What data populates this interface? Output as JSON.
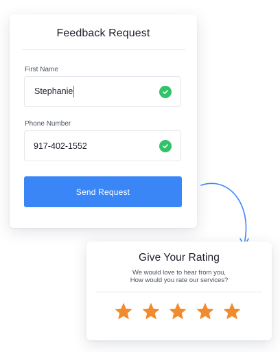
{
  "feedback_form": {
    "title": "Feedback Request",
    "first_name": {
      "label": "First Name",
      "value": "Stephanie",
      "status_icon": "check-circle-icon"
    },
    "phone_number": {
      "label": "Phone Number",
      "value": "917-402-1552",
      "status_icon": "check-circle-icon"
    },
    "submit_label": "Send Request"
  },
  "rating_card": {
    "title": "Give Your Rating",
    "subtitle_line1": "We would love to hear from you,",
    "subtitle_line2": "How would you rate our services?",
    "stars_total": 5,
    "stars_filled": 5,
    "star_icon": "star-icon"
  },
  "colors": {
    "accent_blue": "#3b86f6",
    "success_green": "#31c26a",
    "star_orange": "#f28b2d",
    "text_dark": "#1b1e2b"
  }
}
